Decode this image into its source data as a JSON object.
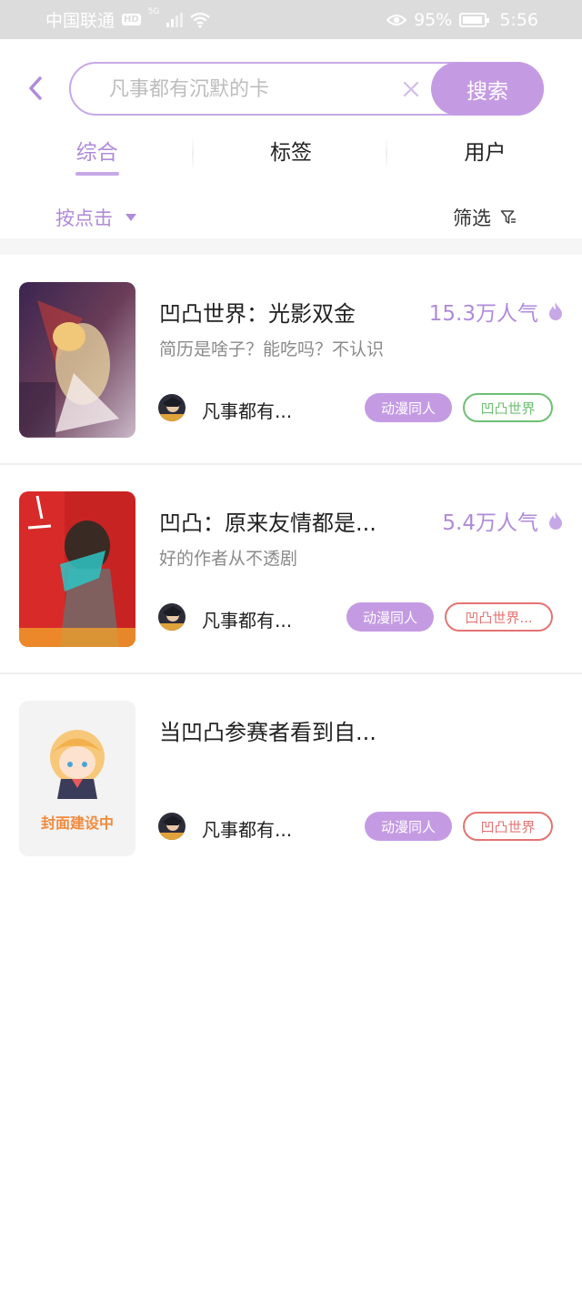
{
  "status_bar": {
    "carrier": "中国联通",
    "hd": "HD",
    "network": "5G",
    "battery": "95%",
    "battery_level": 0.95,
    "time": "5:56"
  },
  "search": {
    "placeholder": "凡事都有沉默的卡",
    "button_label": "搜索"
  },
  "tabs": [
    {
      "label": "综合",
      "active": true
    },
    {
      "label": "标签",
      "active": false
    },
    {
      "label": "用户",
      "active": false
    }
  ],
  "sort": {
    "label": "按点击"
  },
  "filter": {
    "label": "筛选"
  },
  "results": [
    {
      "title": "凹凸世界：光影双金",
      "popularity": "15.3万人气",
      "desc": "简历是啥子？能吃吗？不认识",
      "author": "凡事都有...",
      "tag1": "动漫同人",
      "tag2": "凹凸世界",
      "tag2_color": "#6fbf73"
    },
    {
      "title": "凹凸：原来友情都是...",
      "popularity": "5.4万人气",
      "desc": "好的作者从不透剧",
      "author": "凡事都有...",
      "tag1": "动漫同人",
      "tag2": "凹凸世界...",
      "tag2_color": "#e57373"
    },
    {
      "title": "当凹凸参赛者看到自...",
      "popularity": "",
      "desc": "",
      "author": "凡事都有...",
      "tag1": "动漫同人",
      "tag2": "凹凸世界",
      "tag2_color": "#e57373",
      "cover_text": "封面建设中"
    }
  ],
  "colors": {
    "accent": "#c49be3",
    "accent_text": "#b08bd8",
    "status_bar_bg": "#dcdcdc"
  }
}
